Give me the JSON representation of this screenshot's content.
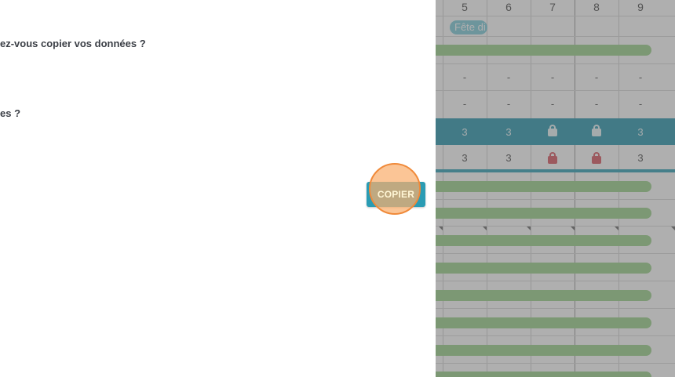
{
  "dialog": {
    "question_1": "ez-vous copier vos données ?",
    "question_2": "es ?",
    "copy_button_label": "COPIER"
  },
  "calendar": {
    "days": [
      "5",
      "6",
      "7",
      "8",
      "9"
    ],
    "holiday_label": "Fête di",
    "dash": "-",
    "teal_row_values": [
      "3",
      "3",
      "lock",
      "lock",
      "3"
    ],
    "count_row_values": [
      "3",
      "3",
      "lock",
      "lock",
      "3"
    ]
  },
  "colors": {
    "accent": "#2a9cb4",
    "teal_row": "#0e8aa5",
    "bar_green": "#8fcc7d",
    "lock_red": "#d4424c",
    "click_highlight": "#f08a3a"
  }
}
